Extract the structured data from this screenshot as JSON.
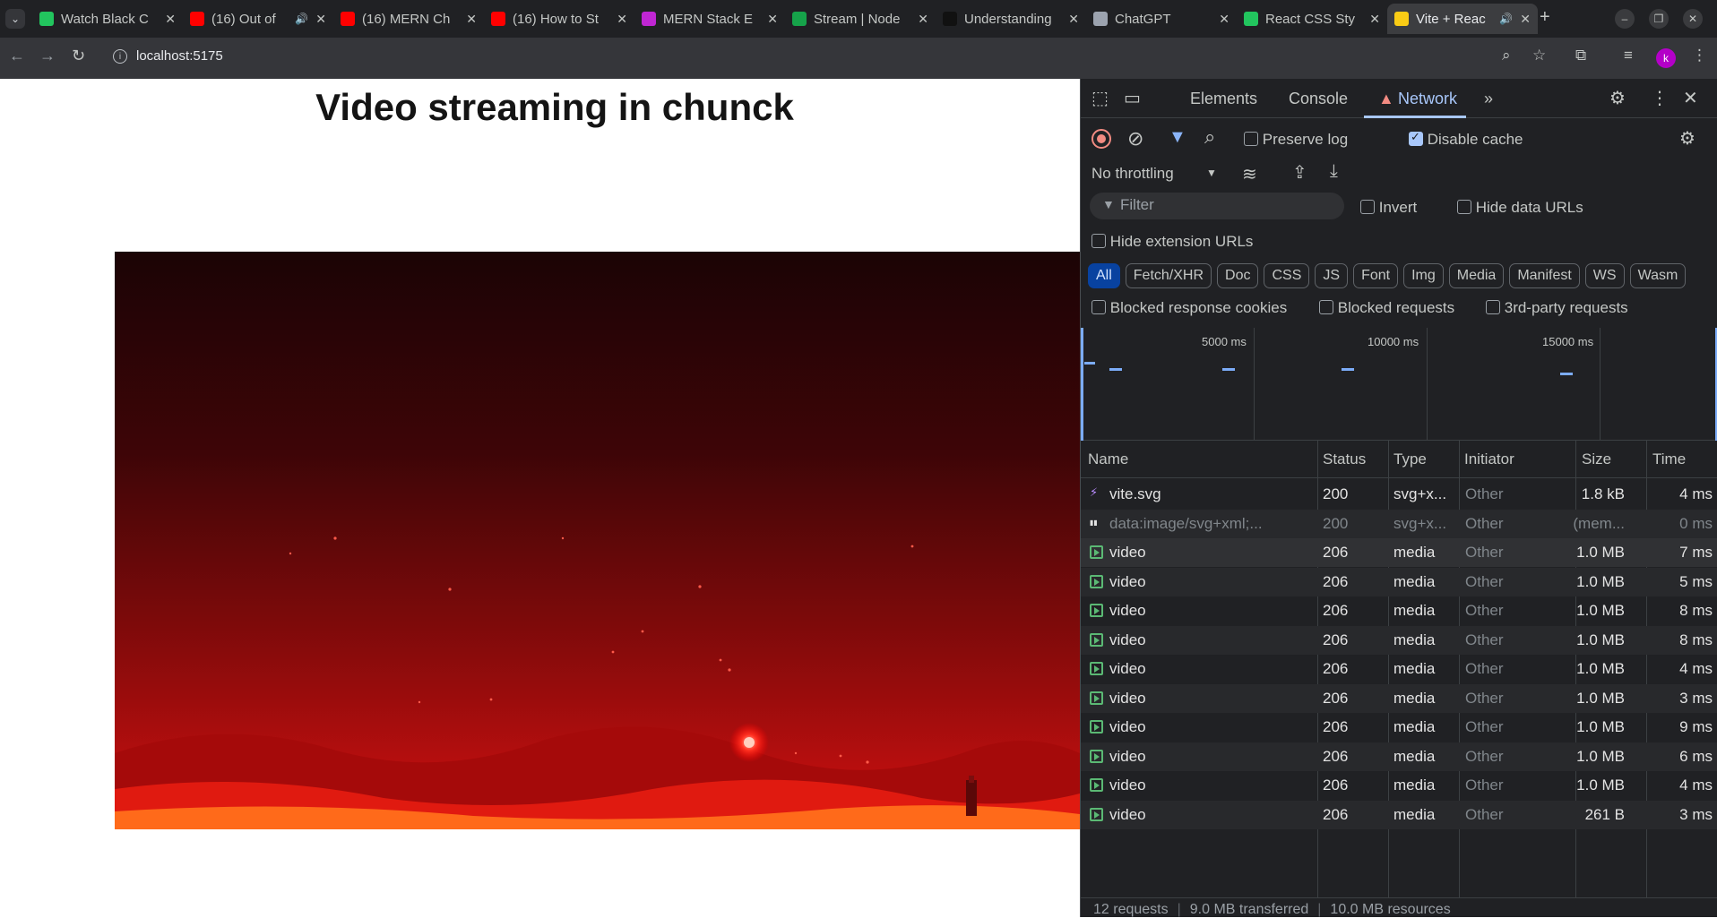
{
  "browser": {
    "tabs": [
      {
        "title": "Watch Black C",
        "color": "#22c55e",
        "audio": false
      },
      {
        "title": "(16) Out of",
        "color": "#ff0000",
        "audio": true
      },
      {
        "title": "(16) MERN Ch",
        "color": "#ff0000",
        "audio": false
      },
      {
        "title": "(16) How to St",
        "color": "#ff0000",
        "audio": false
      },
      {
        "title": "MERN Stack E",
        "color": "#c026d3",
        "audio": false
      },
      {
        "title": "Stream | Node",
        "color": "#16a34a",
        "audio": false
      },
      {
        "title": "Understanding",
        "color": "#111111",
        "audio": false
      },
      {
        "title": "ChatGPT",
        "color": "#9ca3af",
        "audio": false
      },
      {
        "title": "React CSS Sty",
        "color": "#22c55e",
        "audio": false
      },
      {
        "title": "Vite + Reac",
        "color": "#facc15",
        "audio": true,
        "active": true
      }
    ],
    "new_tab": "+",
    "address": "localhost:5175",
    "profile_initial": "k"
  },
  "page": {
    "heading": "Video streaming in chunck"
  },
  "devtools": {
    "tabs": {
      "elements": "Elements",
      "console": "Console",
      "network": "Network",
      "more": "»"
    },
    "toolbar": {
      "preserve_log": "Preserve log",
      "disable_cache": "Disable cache",
      "throttling": "No throttling",
      "filter_placeholder": "Filter",
      "invert": "Invert",
      "hide_data_urls": "Hide data URLs",
      "hide_extension_urls": "Hide extension URLs",
      "blocked_response_cookies": "Blocked response cookies",
      "blocked_requests": "Blocked requests",
      "third_party": "3rd-party requests"
    },
    "checkbox_state": {
      "preserve_log": false,
      "disable_cache": true,
      "invert": false,
      "hide_data_urls": false,
      "hide_extension_urls": false
    },
    "type_filters": [
      "All",
      "Fetch/XHR",
      "Doc",
      "CSS",
      "JS",
      "Font",
      "Img",
      "Media",
      "Manifest",
      "WS",
      "Wasm"
    ],
    "timeline": {
      "labels": [
        "5000 ms",
        "10000 ms",
        "15000 ms"
      ]
    },
    "columns": {
      "name": "Name",
      "status": "Status",
      "type": "Type",
      "initiator": "Initiator",
      "size": "Size",
      "time": "Time"
    },
    "requests": [
      {
        "name": "vite.svg",
        "status": "200",
        "type": "svg+x...",
        "initiator": "Other",
        "size": "1.8 kB",
        "time": "4 ms",
        "icon": "vite"
      },
      {
        "name": "data:image/svg+xml;...",
        "status": "200",
        "type": "svg+x...",
        "initiator": "Other",
        "size": "(mem...",
        "time": "0 ms",
        "icon": "data"
      },
      {
        "name": "video",
        "status": "206",
        "type": "media",
        "initiator": "Other",
        "size": "1.0 MB",
        "time": "7 ms",
        "icon": "media"
      },
      {
        "name": "video",
        "status": "206",
        "type": "media",
        "initiator": "Other",
        "size": "1.0 MB",
        "time": "5 ms",
        "icon": "media"
      },
      {
        "name": "video",
        "status": "206",
        "type": "media",
        "initiator": "Other",
        "size": "1.0 MB",
        "time": "8 ms",
        "icon": "media"
      },
      {
        "name": "video",
        "status": "206",
        "type": "media",
        "initiator": "Other",
        "size": "1.0 MB",
        "time": "8 ms",
        "icon": "media"
      },
      {
        "name": "video",
        "status": "206",
        "type": "media",
        "initiator": "Other",
        "size": "1.0 MB",
        "time": "4 ms",
        "icon": "media"
      },
      {
        "name": "video",
        "status": "206",
        "type": "media",
        "initiator": "Other",
        "size": "1.0 MB",
        "time": "3 ms",
        "icon": "media"
      },
      {
        "name": "video",
        "status": "206",
        "type": "media",
        "initiator": "Other",
        "size": "1.0 MB",
        "time": "9 ms",
        "icon": "media"
      },
      {
        "name": "video",
        "status": "206",
        "type": "media",
        "initiator": "Other",
        "size": "1.0 MB",
        "time": "6 ms",
        "icon": "media"
      },
      {
        "name": "video",
        "status": "206",
        "type": "media",
        "initiator": "Other",
        "size": "1.0 MB",
        "time": "4 ms",
        "icon": "media"
      },
      {
        "name": "video",
        "status": "206",
        "type": "media",
        "initiator": "Other",
        "size": "261 B",
        "time": "3 ms",
        "icon": "media"
      }
    ],
    "summary": {
      "requests": "12 requests",
      "transferred": "9.0 MB transferred",
      "resources": "10.0 MB resources"
    }
  }
}
